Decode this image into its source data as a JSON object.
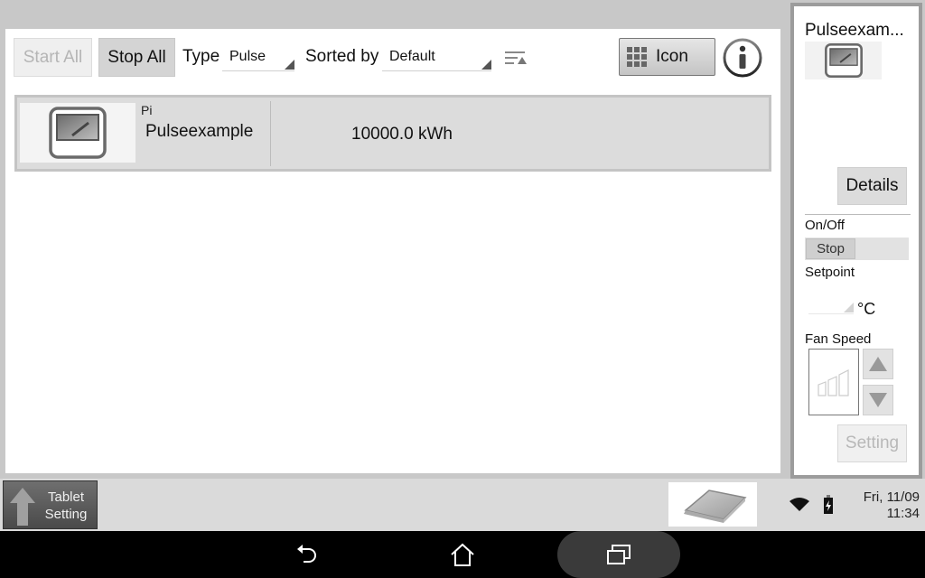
{
  "toolbar": {
    "start_all": "Start All",
    "stop_all": "Stop All",
    "type_label": "Type",
    "type_value": "Pulse",
    "sorted_label": "Sorted by",
    "sorted_value": "Default",
    "view_button": "Icon",
    "sort_icon": "sort-ascending-icon",
    "info_icon": "info-icon"
  },
  "list": {
    "items": [
      {
        "category": "Pi",
        "name": "Pulseexample",
        "value": "10000.0 kWh",
        "icon": "pulse-meter-icon"
      }
    ]
  },
  "side_panel": {
    "title": "Pulseexam...",
    "details_button": "Details",
    "onoff_label": "On/Off",
    "onoff_state": "Stop",
    "setpoint_label": "Setpoint",
    "setpoint_value": "",
    "setpoint_unit": "°C",
    "fan_speed_label": "Fan Speed",
    "setting_button": "Setting"
  },
  "status_bar": {
    "tablet_setting_line1": "Tablet",
    "tablet_setting_line2": "Setting",
    "date": "Fri, 11/09",
    "time": "11:34"
  },
  "nav_bar": {
    "back": "back-icon",
    "home": "home-icon",
    "recent": "recent-apps-icon"
  }
}
